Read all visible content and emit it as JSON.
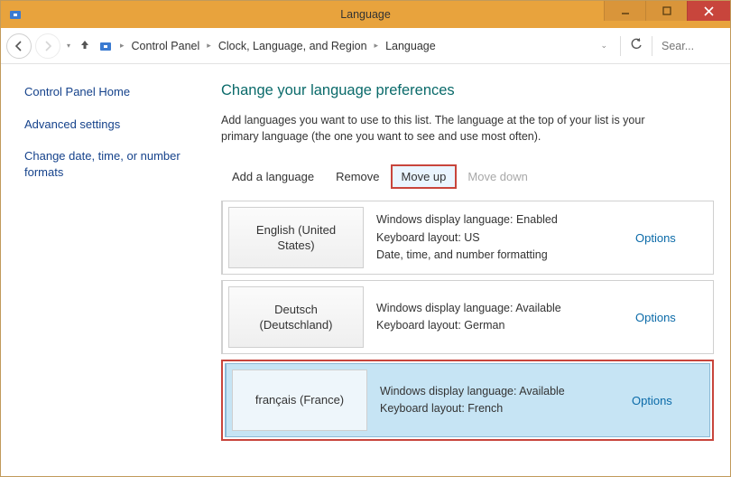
{
  "window": {
    "title": "Language"
  },
  "breadcrumb": {
    "items": [
      "Control Panel",
      "Clock, Language, and Region",
      "Language"
    ],
    "search_placeholder": "Sear..."
  },
  "sidebar": {
    "items": [
      "Control Panel Home",
      "Advanced settings",
      "Change date, time, or number formats"
    ]
  },
  "main": {
    "heading": "Change your language preferences",
    "description": "Add languages you want to use to this list. The language at the top of your list is your primary language (the one you want to see and use most often).",
    "toolbar": {
      "add": "Add a language",
      "remove": "Remove",
      "move_up": "Move up",
      "move_down": "Move down"
    },
    "languages": [
      {
        "name": "English (United States)",
        "display": "Windows display language: Enabled",
        "keyboard": "Keyboard layout: US",
        "extra": "Date, time, and number formatting",
        "options": "Options",
        "selected": false
      },
      {
        "name": "Deutsch (Deutschland)",
        "display": "Windows display language: Available",
        "keyboard": "Keyboard layout: German",
        "extra": "",
        "options": "Options",
        "selected": false
      },
      {
        "name": "français (France)",
        "display": "Windows display language: Available",
        "keyboard": "Keyboard layout: French",
        "extra": "",
        "options": "Options",
        "selected": true
      }
    ]
  }
}
